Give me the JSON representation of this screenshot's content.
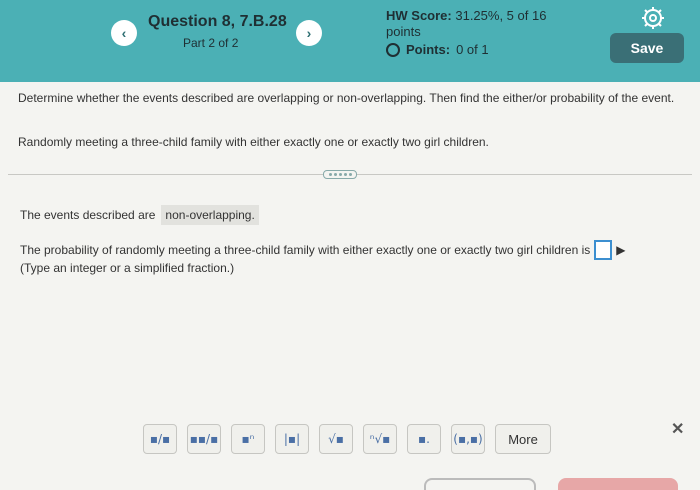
{
  "header": {
    "question_title": "Question 8, 7.B.28",
    "part_label": "Part 2 of 2",
    "hw_score_label": "HW Score:",
    "hw_score_value": "31.25%, 5 of 16",
    "hw_score_unit": "points",
    "points_label": "Points:",
    "points_value": "0 of 1",
    "save_label": "Save",
    "prev_icon": "chevron-left-icon",
    "next_icon": "chevron-right-icon",
    "settings_icon": "gear-icon"
  },
  "problem": {
    "instructions": "Determine whether the events described are overlapping or non-overlapping. Then find the either/or probability of the event.",
    "scenario": "Randomly meeting a three-child family with either exactly one or exactly two girl children."
  },
  "answers": {
    "events_prefix": "The events described are",
    "events_answer": "non-overlapping.",
    "probability_prompt": "The probability of randomly meeting a three-child family with either exactly one or exactly two girl children is",
    "probability_value": "",
    "type_hint": "(Type an integer or a simplified fraction.)"
  },
  "toolbar": {
    "tools": [
      {
        "name": "fraction-tool",
        "glyph": "▪/▪"
      },
      {
        "name": "mixed-number-tool",
        "glyph": "▪▪/▪"
      },
      {
        "name": "exponent-tool",
        "glyph": "▪ⁿ"
      },
      {
        "name": "absolute-value-tool",
        "glyph": "|▪|"
      },
      {
        "name": "square-root-tool",
        "glyph": "√▪"
      },
      {
        "name": "nth-root-tool",
        "glyph": "ⁿ√▪"
      },
      {
        "name": "decimal-tool",
        "glyph": "▪."
      },
      {
        "name": "ordered-pair-tool",
        "glyph": "(▪,▪)"
      }
    ],
    "more_label": "More",
    "close_icon": "close-icon"
  },
  "colors": {
    "header_bg": "#4bb0b5",
    "save_bg": "#3a6f76",
    "input_border": "#3c8fd0"
  }
}
